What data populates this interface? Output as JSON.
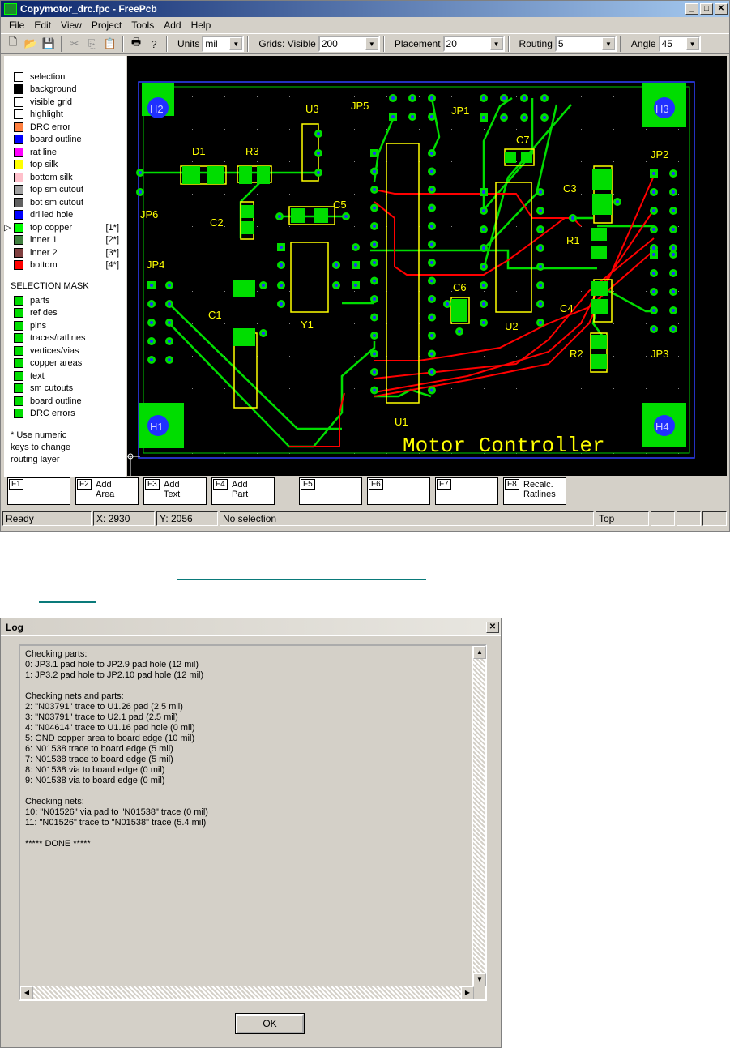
{
  "app": {
    "title": "Copymotor_drc.fpc - FreePcb",
    "menu": [
      "File",
      "Edit",
      "View",
      "Project",
      "Tools",
      "Add",
      "Help"
    ],
    "units_label": "Units",
    "units_value": "mil",
    "grids_label": "Grids: Visible",
    "grids_value": "200",
    "placement_label": "Placement",
    "placement_value": "20",
    "routing_label": "Routing",
    "routing_value": "5",
    "angle_label": "Angle",
    "angle_value": "45",
    "layers": [
      {
        "label": "selection",
        "color": "#ffffff",
        "num": ""
      },
      {
        "label": "background",
        "color": "#000000",
        "num": ""
      },
      {
        "label": "visible grid",
        "color": "#ffffff",
        "num": ""
      },
      {
        "label": "highlight",
        "color": "#ffffff",
        "num": ""
      },
      {
        "label": "DRC error",
        "color": "#ff8040",
        "num": ""
      },
      {
        "label": "board outline",
        "color": "#0000ff",
        "num": ""
      },
      {
        "label": "rat line",
        "color": "#ff00ff",
        "num": ""
      },
      {
        "label": "top silk",
        "color": "#ffff00",
        "num": ""
      },
      {
        "label": "bottom silk",
        "color": "#ffc0cb",
        "num": ""
      },
      {
        "label": "top sm cutout",
        "color": "#a0a0a0",
        "num": ""
      },
      {
        "label": "bot sm cutout",
        "color": "#606060",
        "num": ""
      },
      {
        "label": "drilled hole",
        "color": "#0000ff",
        "num": ""
      },
      {
        "label": "top copper",
        "color": "#00ff00",
        "num": "[1*]"
      },
      {
        "label": "inner 1",
        "color": "#408040",
        "num": "[2*]"
      },
      {
        "label": "inner 2",
        "color": "#804040",
        "num": "[3*]"
      },
      {
        "label": "bottom",
        "color": "#ff0000",
        "num": "[4*]"
      }
    ],
    "selection_mask_title": "SELECTION MASK",
    "selection_mask": [
      "parts",
      "ref des",
      "pins",
      "traces/ratlines",
      "vertices/vias",
      "copper areas",
      "text",
      "sm cutouts",
      "board outline",
      "DRC errors"
    ],
    "note_lines": [
      "* Use numeric",
      "keys to change",
      "routing layer"
    ],
    "fkeys": [
      {
        "key": "F1",
        "line1": "",
        "line2": ""
      },
      {
        "key": "F2",
        "line1": "Add",
        "line2": "Area"
      },
      {
        "key": "F3",
        "line1": "Add",
        "line2": "Text"
      },
      {
        "key": "F4",
        "line1": "Add",
        "line2": "Part"
      },
      {
        "key": "F5",
        "line1": "",
        "line2": ""
      },
      {
        "key": "F6",
        "line1": "",
        "line2": ""
      },
      {
        "key": "F7",
        "line1": "",
        "line2": ""
      },
      {
        "key": "F8",
        "line1": "Recalc.",
        "line2": "Ratlines"
      }
    ],
    "status": {
      "ready": "Ready",
      "x": "X: 2930",
      "y": "Y: 2056",
      "selection": "No selection",
      "layer": "Top"
    },
    "board": {
      "labels": [
        "H1",
        "H2",
        "H3",
        "H4",
        "JP1",
        "JP2",
        "JP3",
        "JP4",
        "JP5",
        "JP6",
        "U1",
        "U2",
        "U3",
        "D1",
        "R1",
        "R2",
        "R3",
        "C1",
        "C2",
        "C3",
        "C4",
        "C5",
        "C6",
        "C7",
        "Y1"
      ],
      "text": "Motor Controller"
    }
  },
  "log": {
    "title": "Log",
    "lines": [
      "Checking parts:",
      "0: JP3.1 pad hole to JP2.9 pad hole (12 mil)",
      "1: JP3.2 pad hole to JP2.10 pad hole (12 mil)",
      "",
      "Checking nets and parts:",
      "2: \"N03791\" trace to U1.26 pad (2.5 mil)",
      "3: \"N03791\" trace to U2.1 pad (2.5 mil)",
      "4: \"N04614\" trace to U1.16 pad hole (0 mil)",
      "5: GND copper area to board edge (10 mil)",
      "6: N01538 trace to board edge (5 mil)",
      "7: N01538 trace to board edge (5 mil)",
      "8: N01538 via to board edge (0 mil)",
      "9: N01538 via to board edge (0 mil)",
      "",
      "Checking nets:",
      "10: \"N01526\" via pad to \"N01538\" trace (0 mil)",
      "11: \"N01526\" trace to \"N01538\" trace (5.4 mil)",
      "",
      "***** DONE *****"
    ],
    "ok_label": "OK"
  }
}
